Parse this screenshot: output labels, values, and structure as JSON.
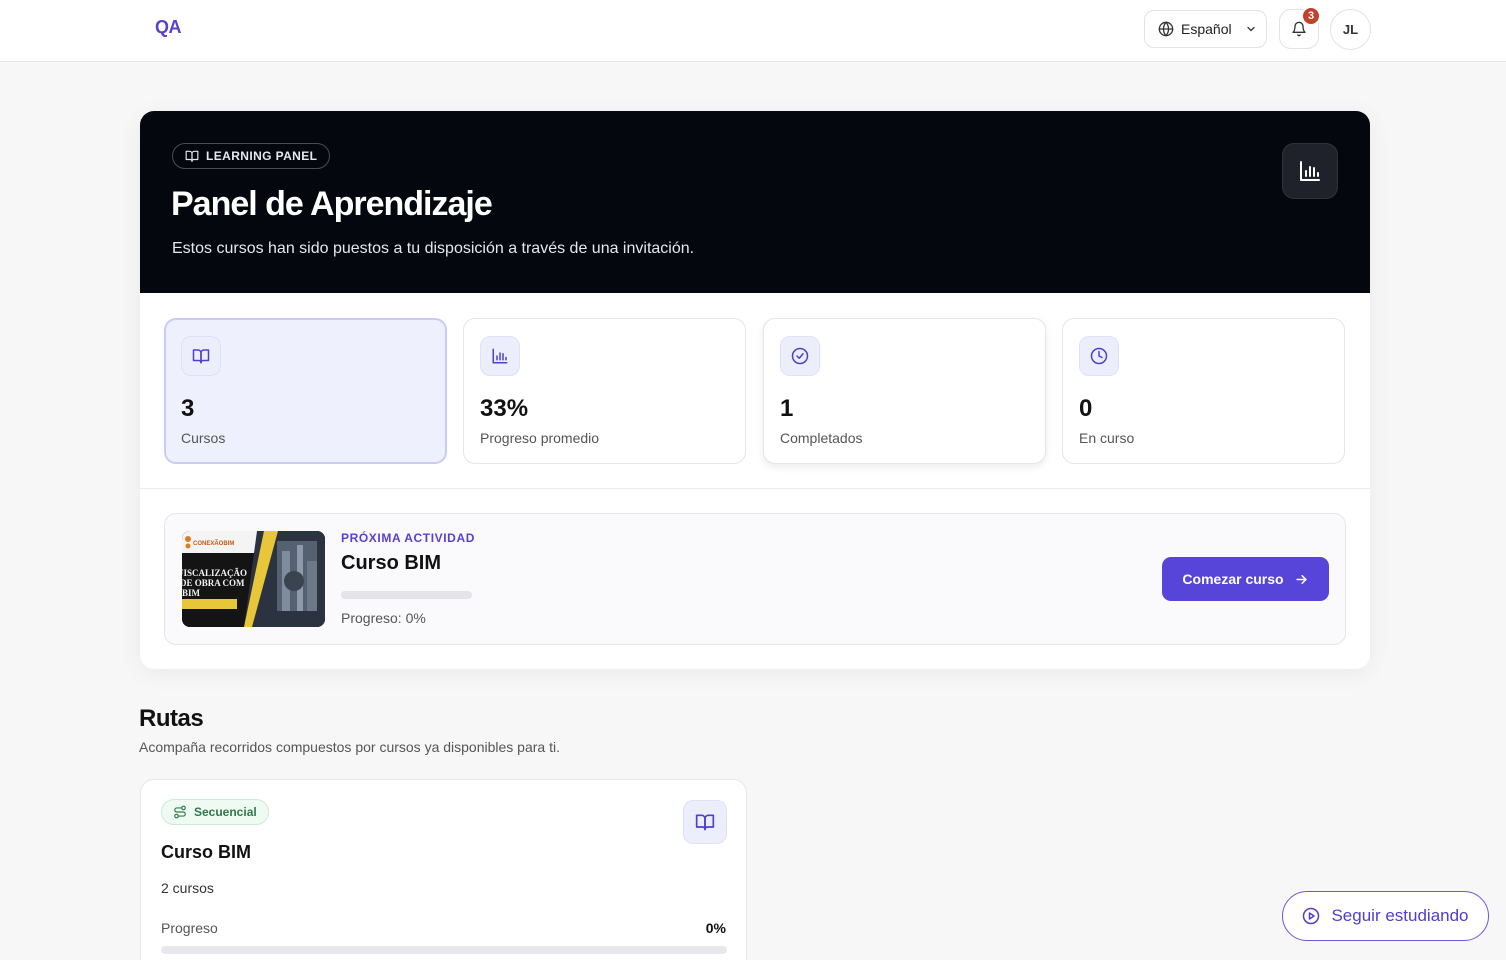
{
  "header": {
    "logo": "QA",
    "language": "Español",
    "notifications_count": "3",
    "avatar_initials": "JL"
  },
  "hero": {
    "eyebrow": "LEARNING PANEL",
    "title": "Panel de Aprendizaje",
    "subtitle": "Estos cursos han sido puestos a tu disposición a través de una invitación."
  },
  "stats": [
    {
      "value": "3",
      "label": "Cursos",
      "icon": "book-open-icon"
    },
    {
      "value": "33%",
      "label": "Progreso promedio",
      "icon": "bar-chart-icon"
    },
    {
      "value": "1",
      "label": "Completados",
      "icon": "check-circle-icon"
    },
    {
      "value": "0",
      "label": "En curso",
      "icon": "clock-icon"
    }
  ],
  "next_activity": {
    "eyebrow": "PRÓXIMA ACTIVIDAD",
    "title": "Curso BIM",
    "progress_text": "Progreso: 0%",
    "progress_fraction": 0,
    "button_label": "Comezar curso",
    "thumbnail": {
      "brand": "CONEXÃOBIM",
      "line1": "FISCALIZAÇÃO",
      "line2": "DE OBRA COM",
      "line3": "BIM"
    }
  },
  "routes": {
    "title": "Rutas",
    "subtitle": "Acompaña recorridos compuestos por cursos ya disponibles para ti.",
    "cards": [
      {
        "badge": "Secuencial",
        "title": "Curso BIM",
        "count": "2 cursos",
        "progress_label": "Progreso",
        "progress_value": "0%",
        "progress_fraction": 0
      }
    ]
  },
  "floating_button": {
    "label": "Seguir estudiando"
  },
  "colors": {
    "accent": "#5744d8",
    "hero_bg": "#05070f",
    "badge": "#c2412d"
  }
}
